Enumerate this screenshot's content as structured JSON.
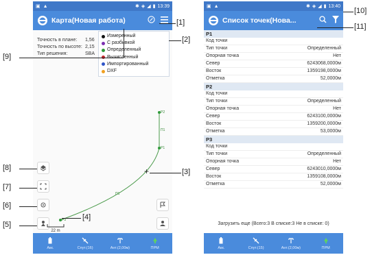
{
  "left": {
    "status": {
      "time": "13:39"
    },
    "title": "Карта(Новая работа)",
    "info": [
      {
        "label": "Точность в плане:",
        "value": "1,56"
      },
      {
        "label": "Точность по высоте:",
        "value": "2,15"
      },
      {
        "label": "Тип решения:",
        "value": "SBA"
      }
    ],
    "legend": [
      {
        "label": "Измеренный",
        "color": "#111111"
      },
      {
        "label": "С разбивкой",
        "color": "#7b2fb0"
      },
      {
        "label": "Определенный",
        "color": "#2f9a3a"
      },
      {
        "label": "Вычисленный",
        "color": "#c0262d"
      },
      {
        "label": "Импортированный",
        "color": "#2f55c8"
      },
      {
        "label": "DXF",
        "color": "#f0a020"
      }
    ],
    "points": {
      "p1": "P1",
      "p2": "P2",
      "p3": "P3",
      "seg1": "П1",
      "seg2": "П1"
    },
    "scale": "22 m",
    "crosshair": "+"
  },
  "right": {
    "status": {
      "time": "13:40"
    },
    "title": "Список точек(Нова...",
    "points": [
      {
        "name": "P1",
        "rows": [
          {
            "k": "Код точки",
            "v": ""
          },
          {
            "k": "Тип точки",
            "v": "Определенный"
          },
          {
            "k": "Опорная точка",
            "v": "Нет"
          },
          {
            "k": "Север",
            "v": "6243068,0000м"
          },
          {
            "k": "Восток",
            "v": "1359198,0000м"
          },
          {
            "k": "Отметка",
            "v": "52,0000м"
          }
        ]
      },
      {
        "name": "P2",
        "rows": [
          {
            "k": "Код точки",
            "v": ""
          },
          {
            "k": "Тип точки",
            "v": "Определенный"
          },
          {
            "k": "Опорная точка",
            "v": "Нет"
          },
          {
            "k": "Север",
            "v": "6243100,0000м"
          },
          {
            "k": "Восток",
            "v": "1359200,0000м"
          },
          {
            "k": "Отметка",
            "v": "53,0000м"
          }
        ]
      },
      {
        "name": "P3",
        "rows": [
          {
            "k": "Код точки",
            "v": ""
          },
          {
            "k": "Тип точки",
            "v": "Определенный"
          },
          {
            "k": "Опорная точка",
            "v": "Нет"
          },
          {
            "k": "Север",
            "v": "6243010,0000м"
          },
          {
            "k": "Восток",
            "v": "1359108,0000м"
          },
          {
            "k": "Отметка",
            "v": "52,0000м"
          }
        ]
      }
    ],
    "load_more": "Загрузить еще (Всего:3 В списке:3 Не в списке: 0)"
  },
  "bottom_bar": [
    {
      "label": "Акк.",
      "icon": "battery-icon"
    },
    {
      "label": "Спут.(16)",
      "icon": "satellite-icon"
    },
    {
      "label": "Ант.(2,00м)",
      "icon": "antenna-icon"
    },
    {
      "label": "ПРМ",
      "icon": "rover-icon"
    }
  ],
  "bottom_bar_right": [
    {
      "label": "Акк.",
      "icon": "battery-icon"
    },
    {
      "label": "Спут.(15)",
      "icon": "satellite-icon"
    },
    {
      "label": "Ант.(2,00м)",
      "icon": "antenna-icon"
    },
    {
      "label": "ПРМ",
      "icon": "rover-icon"
    }
  ],
  "callouts": {
    "c1": "[1]",
    "c2": "[2]",
    "c3": "[3]",
    "c4": "[4]",
    "c5": "[5]",
    "c6": "[6]",
    "c7": "[7]",
    "c8": "[8]",
    "c9": "[9]",
    "c10": "[10]",
    "c11": "[11]"
  },
  "colors": {
    "appbar": "#4a8bdc",
    "statusbar": "#3f78c8",
    "track": "#4a9a4a"
  }
}
